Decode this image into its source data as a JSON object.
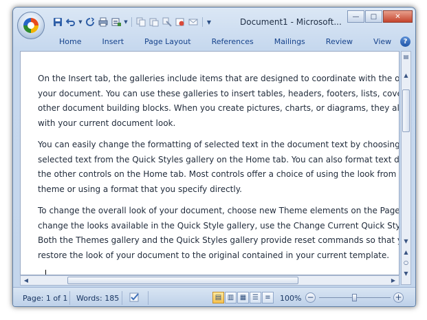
{
  "window": {
    "title": "Document1 - Microsoft...",
    "minimize_glyph": "—",
    "maximize_glyph": "□",
    "close_glyph": "✕"
  },
  "quick_access": {
    "icons": [
      "save-icon",
      "undo-icon",
      "undo-dropdown-icon",
      "redo-icon",
      "print-icon",
      "form-icon",
      "copy-icon",
      "paste-icon",
      "format-painter-icon",
      "spelling-icon",
      "email-icon",
      "customize-dropdown-icon"
    ]
  },
  "ribbon": {
    "tabs": [
      "Home",
      "Insert",
      "Page Layout",
      "References",
      "Mailings",
      "Review",
      "View"
    ],
    "help_glyph": "?"
  },
  "document": {
    "paragraphs": [
      [
        "On the Insert tab, the galleries include items that are designed to coordinate with the ov",
        "your document. You can use these galleries to insert tables, headers, footers, lists, cover",
        "other document building blocks. When you create pictures, charts, or diagrams, they also",
        "with your current document look."
      ],
      [
        "You can easily change the formatting of selected text in the document text by choosing a",
        "selected text from the Quick Styles gallery on the Home tab. You can also format text dir",
        "the other controls on the Home tab. Most controls offer a choice of using the look from t",
        "theme or using a format that you specify directly."
      ],
      [
        "To change the overall look of your document, choose new Theme elements on the Page",
        "change the looks available in the Quick Style gallery, use the Change Current Quick Style",
        "Both the Themes gallery and the Quick Styles gallery provide reset commands so that yo",
        "restore the look of your document to the original contained in your current template."
      ]
    ]
  },
  "status": {
    "page": "Page: 1 of 1",
    "words": "Words: 185",
    "zoom": "100%",
    "zoom_level_percent": 100
  },
  "colors": {
    "accent": "#15428b",
    "close_button": "#c5442d",
    "active_view": "#f6c24f"
  }
}
